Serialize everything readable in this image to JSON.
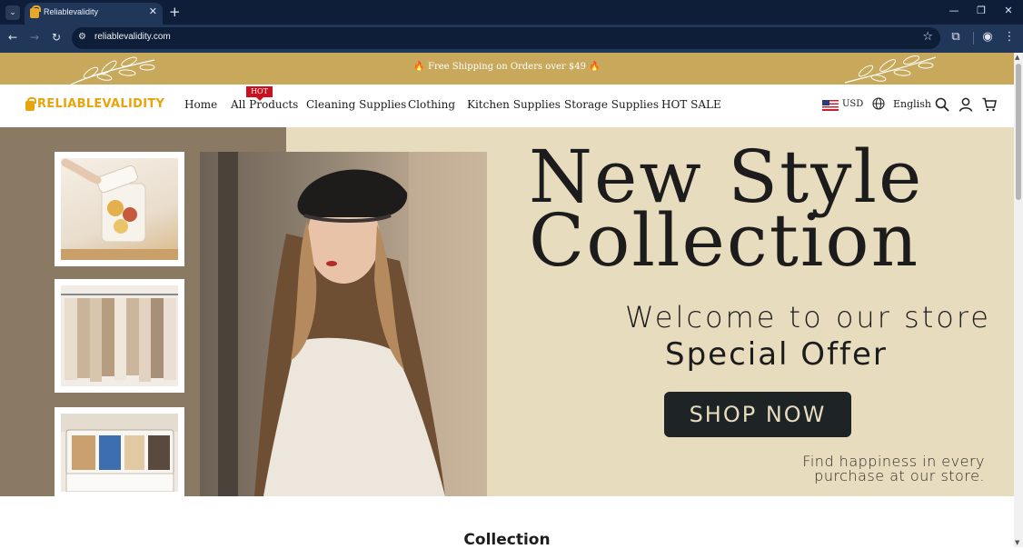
{
  "browser": {
    "tab_title": "Reliablevalidity",
    "tab_close": "✕",
    "new_tab": "+",
    "url": "reliablevalidity.com",
    "window_controls": [
      "—",
      "❐",
      "✕"
    ]
  },
  "promo": {
    "text": "🔥 Free Shipping on Orders over $49 🔥"
  },
  "header": {
    "logo": "RELIABLEVALIDITY",
    "hot_badge": "HOT",
    "nav": [
      "Home",
      "All Products",
      "Cleaning Supplies",
      "Clothing",
      "Kitchen Supplies",
      "Storage Supplies",
      "HOT SALE"
    ],
    "currency": "USD",
    "language": "English"
  },
  "hero": {
    "title_line1": "New Style",
    "title_line2": "Collection",
    "welcome": "Welcome to our store",
    "offer": "Special Offer",
    "cta": "SHOP NOW",
    "tagline_line1": "Find happiness in every",
    "tagline_line2": "purchase at our store."
  },
  "section": {
    "title": "Collection"
  },
  "colors": {
    "browser_frame": "#0f1e38",
    "toolbar": "#213759",
    "promo_gold": "#c8a85a",
    "logo_orange": "#e8a40c",
    "hot_red": "#c8101e",
    "hero_beige": "#e8dcbf",
    "hero_taupe": "#8a7a64",
    "cta_dark": "#1e2426"
  }
}
